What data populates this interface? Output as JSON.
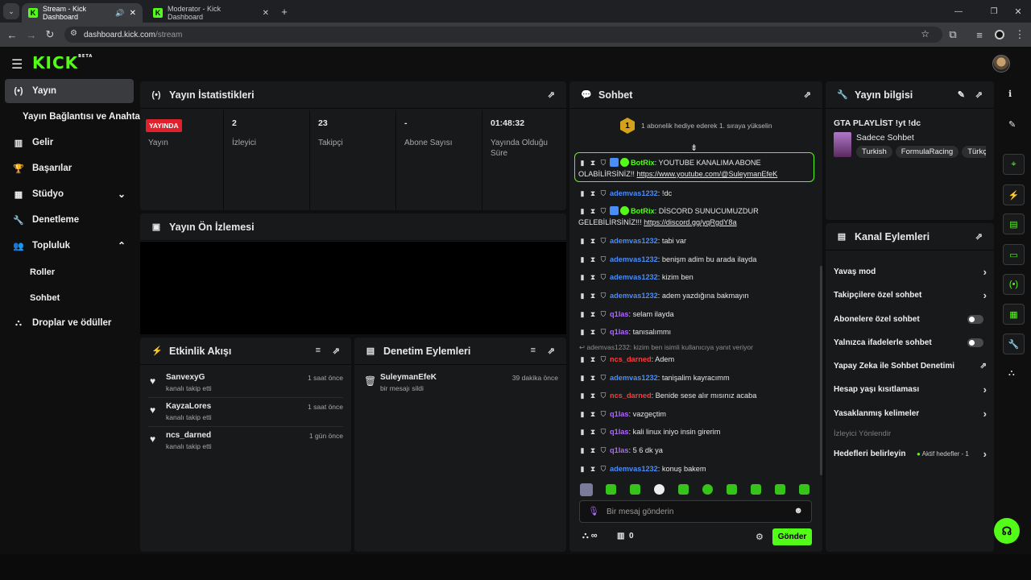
{
  "browser": {
    "tabs": [
      {
        "title": "Stream - Kick Dashboard",
        "active": true
      },
      {
        "title": "Moderator - Kick Dashboard",
        "active": false
      }
    ],
    "url_host": "dashboard.kick.com",
    "url_path": "/stream"
  },
  "app": {
    "logo": "KICK",
    "logo_beta": "BETA"
  },
  "sidebar": {
    "items": [
      {
        "label": "Yayın",
        "icon": "broadcast-icon"
      },
      {
        "label": "Yayın Bağlantısı ve Anahtarı"
      },
      {
        "label": "Gelir",
        "icon": "chart-icon"
      },
      {
        "label": "Başarılar",
        "icon": "trophy-icon"
      },
      {
        "label": "Stüdyo",
        "icon": "studio-icon"
      },
      {
        "label": "Denetleme",
        "icon": "wrench-icon"
      },
      {
        "label": "Topluluk",
        "icon": "community-icon"
      },
      {
        "label": "Roller"
      },
      {
        "label": "Sohbet"
      },
      {
        "label": "Droplar ve ödüller",
        "icon": "drops-icon"
      }
    ]
  },
  "stats": {
    "title": "Yayın İstatistikleri",
    "live_badge": "YAYINDA",
    "cols": [
      {
        "value": "",
        "label": "Yayın"
      },
      {
        "value": "2",
        "label": "İzleyici"
      },
      {
        "value": "23",
        "label": "Takipçi"
      },
      {
        "value": "-",
        "label": "Abone Sayısı"
      },
      {
        "value": "01:48:32",
        "label": "Yayında Olduğu Süre"
      }
    ]
  },
  "preview": {
    "title": "Yayın Ön İzlemesi"
  },
  "activity": {
    "title": "Etkinlik Akışı",
    "items": [
      {
        "name": "SanvexyG",
        "sub": "kanalı takip etti",
        "time": "1 saat önce"
      },
      {
        "name": "KayzaLores",
        "sub": "kanalı takip etti",
        "time": "1 saat önce"
      },
      {
        "name": "ncs_darned",
        "sub": "kanalı takip etti",
        "time": "1 gün önce"
      }
    ]
  },
  "modactions": {
    "title": "Denetim Eylemleri",
    "items": [
      {
        "name": "SuleymanEfeK",
        "sub": "bir mesajı sildi",
        "time": "39 dakika önce"
      }
    ]
  },
  "chat": {
    "title": "Sohbet",
    "gift_banner": "1 abonelik hediye ederek 1. sıraya yükselin",
    "gift_rank": "1",
    "reply_hint": "ademvas1232: kizim ben isimli kullanıcıya yanıt veriyor",
    "messages": [
      {
        "user": "BotRix",
        "color": "green",
        "text": "YOUTUBE KANALIMA ABONE OLABİLİRSİNİZ!! ",
        "link": "https://www.youtube.com/@SuleymanEfeK"
      },
      {
        "user": "ademvas1232",
        "color": "blue",
        "text": "!dc"
      },
      {
        "user": "BotRix",
        "color": "green",
        "text": "DİSCORD SUNUCUMUZDUR GELEBİLİRSİNİZ!!! ",
        "link": "https://discord.gg/yqRgdY8a"
      },
      {
        "user": "ademvas1232",
        "color": "blue",
        "text": "tabi var"
      },
      {
        "user": "ademvas1232",
        "color": "blue",
        "text": "benişm adim bu arada ilayda"
      },
      {
        "user": "ademvas1232",
        "color": "blue",
        "text": "kizim ben"
      },
      {
        "user": "ademvas1232",
        "color": "blue",
        "text": "adem yazdığına bakmayın"
      },
      {
        "user": "q1las",
        "color": "purple",
        "text": "selam ilayda"
      },
      {
        "user": "q1las",
        "color": "purple",
        "text": "tanısalımmı"
      },
      {
        "user": "ncs_darned",
        "color": "red",
        "text": "Adem"
      },
      {
        "user": "ademvas1232",
        "color": "blue",
        "text": "tanişalim kayracımm"
      },
      {
        "user": "ncs_darned",
        "color": "red",
        "text": "Benide sese alır mısınız acaba"
      },
      {
        "user": "q1las",
        "color": "purple",
        "text": "vazgeçtim"
      },
      {
        "user": "q1las",
        "color": "purple",
        "text": "kali linux iniyo insin girerim"
      },
      {
        "user": "q1las",
        "color": "purple",
        "text": "5 6 dk ya"
      },
      {
        "user": "ademvas1232",
        "color": "blue",
        "text": "konuş bakem"
      }
    ],
    "input_placeholder": "Bir mesaj gönderin",
    "points": "∞",
    "store_count": "0",
    "send_label": "Gönder"
  },
  "info": {
    "title": "Yayın bilgisi",
    "stream_title": "GTA PLAYLİST !yt !dc",
    "category": "Sadece Sohbet",
    "tags": [
      "Turkish",
      "FormulaRacing",
      "Türkç"
    ]
  },
  "channel_actions": {
    "title": "Kanal Eylemleri",
    "rows": [
      {
        "label": "Yavaş mod",
        "type": "chevron"
      },
      {
        "label": "Takipçilere özel sohbet",
        "type": "chevron"
      },
      {
        "label": "Abonelere özel sohbet",
        "type": "toggle"
      },
      {
        "label": "Yalnızca ifadelerle sohbet",
        "type": "toggle"
      },
      {
        "label": "Yapay Zeka ile Sohbet Denetimi",
        "type": "external"
      },
      {
        "label": "Hesap yaşı kısıtlaması",
        "type": "chevron"
      },
      {
        "label": "Yasaklanmış kelimeler",
        "type": "chevron"
      }
    ],
    "section_label": "İzleyici Yönlendir",
    "goals_label": "Hedefleri belirleyin",
    "goals_status": "Aktif hedefler - 1"
  },
  "colors": {
    "accent": "#53fc18",
    "live": "#e0202a",
    "panel": "#18191b"
  }
}
